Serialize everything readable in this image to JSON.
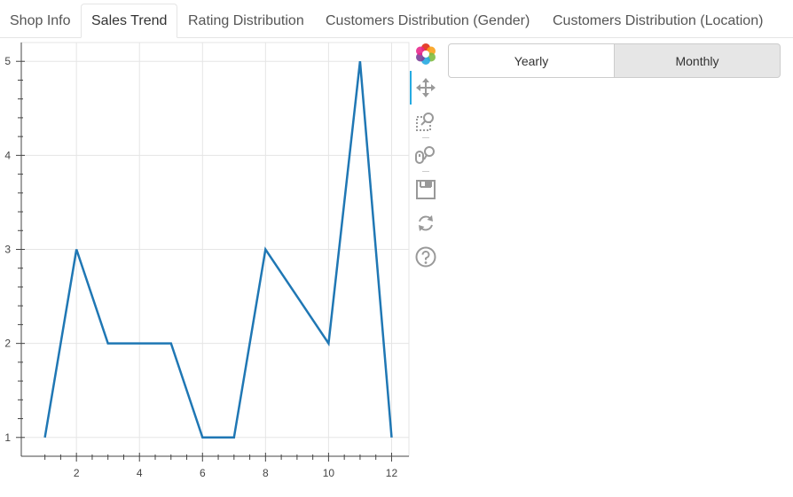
{
  "tabs": [
    "Shop Info",
    "Sales Trend",
    "Rating Distribution",
    "Customers Distribution (Gender)",
    "Customers Distribution (Location)"
  ],
  "active_tab": "Sales Trend",
  "toolbar": {
    "tools": [
      "bokeh-logo-icon",
      "pan-icon",
      "box-zoom-icon",
      "wheel-zoom-icon",
      "save-icon",
      "reset-icon",
      "help-icon"
    ]
  },
  "range_buttons": {
    "yearly": "Yearly",
    "monthly": "Monthly",
    "selected": "Monthly"
  },
  "chart_data": {
    "type": "line",
    "x": [
      1,
      2,
      3,
      4,
      5,
      6,
      7,
      8,
      9,
      10,
      11,
      12
    ],
    "series": [
      {
        "values": [
          1,
          3,
          2,
          2,
          2,
          1,
          1,
          3,
          2.5,
          2,
          5,
          1
        ],
        "color": "#1f77b4"
      }
    ],
    "xticks": [
      2,
      4,
      6,
      8,
      10,
      12
    ],
    "yticks": [
      1,
      2,
      3,
      4,
      5
    ],
    "xlim": [
      0.25,
      12.55
    ],
    "ylim": [
      0.8,
      5.2
    ],
    "grid": true
  }
}
